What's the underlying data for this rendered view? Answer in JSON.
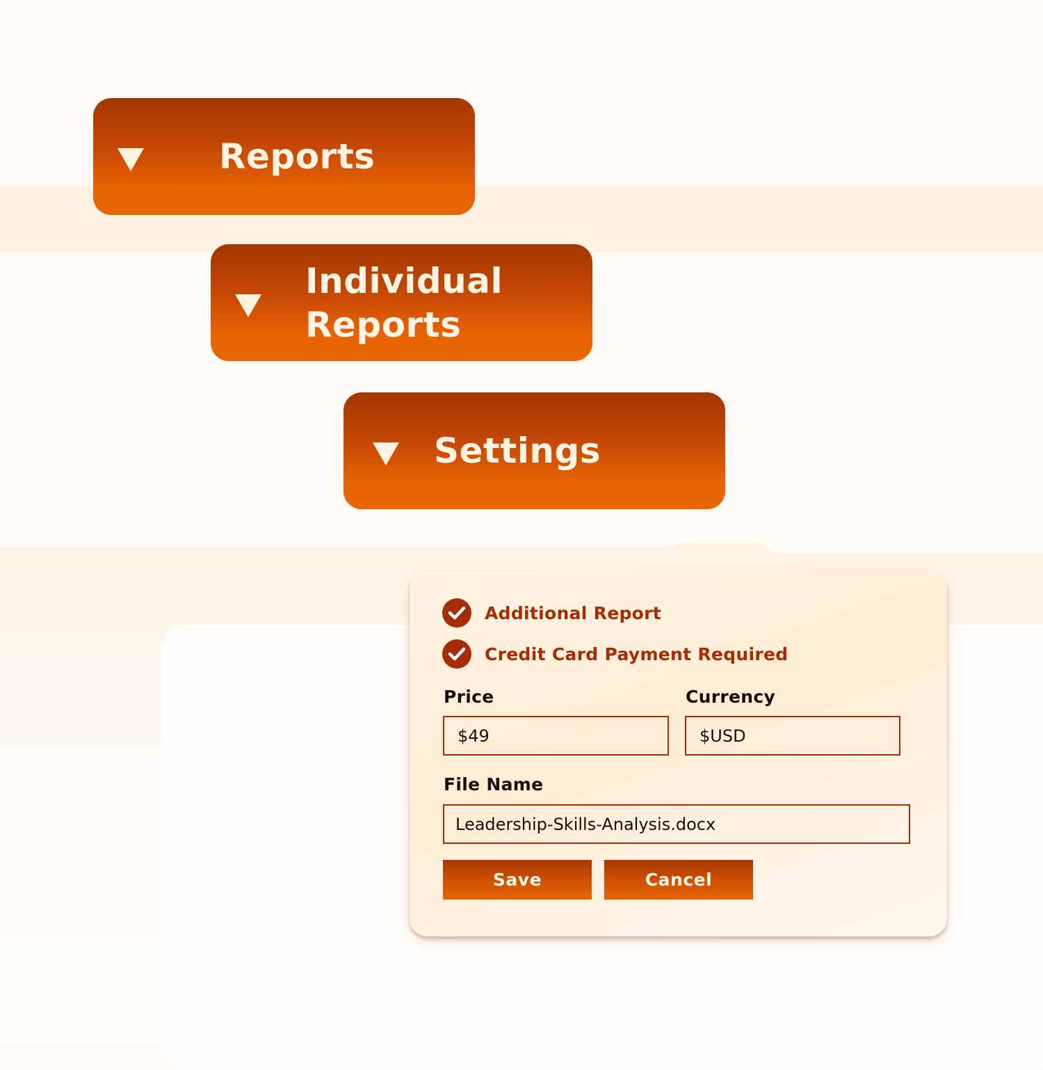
{
  "menu": {
    "items": [
      {
        "label": "Reports",
        "icon": "caret-down-icon"
      },
      {
        "label": "Individual\nReports",
        "icon": "caret-down-icon"
      },
      {
        "label": "Settings",
        "icon": "caret-down-icon"
      }
    ]
  },
  "form": {
    "options": [
      {
        "label": "Additional Report",
        "checked": true,
        "icon": "check-circle-icon"
      },
      {
        "label": "Credit Card Payment Required",
        "checked": true,
        "icon": "check-circle-icon"
      }
    ],
    "price": {
      "label": "Price",
      "value": "$49"
    },
    "currency": {
      "label": "Currency",
      "value": "$USD"
    },
    "file_name": {
      "label": "File Name",
      "value": "Leadership-Skills-Analysis.docx"
    },
    "save_label": "Save",
    "cancel_label": "Cancel"
  },
  "colors": {
    "accent_dark": "#a52c06",
    "accent_bright": "#e86403",
    "button_text": "#fff3e1",
    "background": "#fffaf5"
  }
}
